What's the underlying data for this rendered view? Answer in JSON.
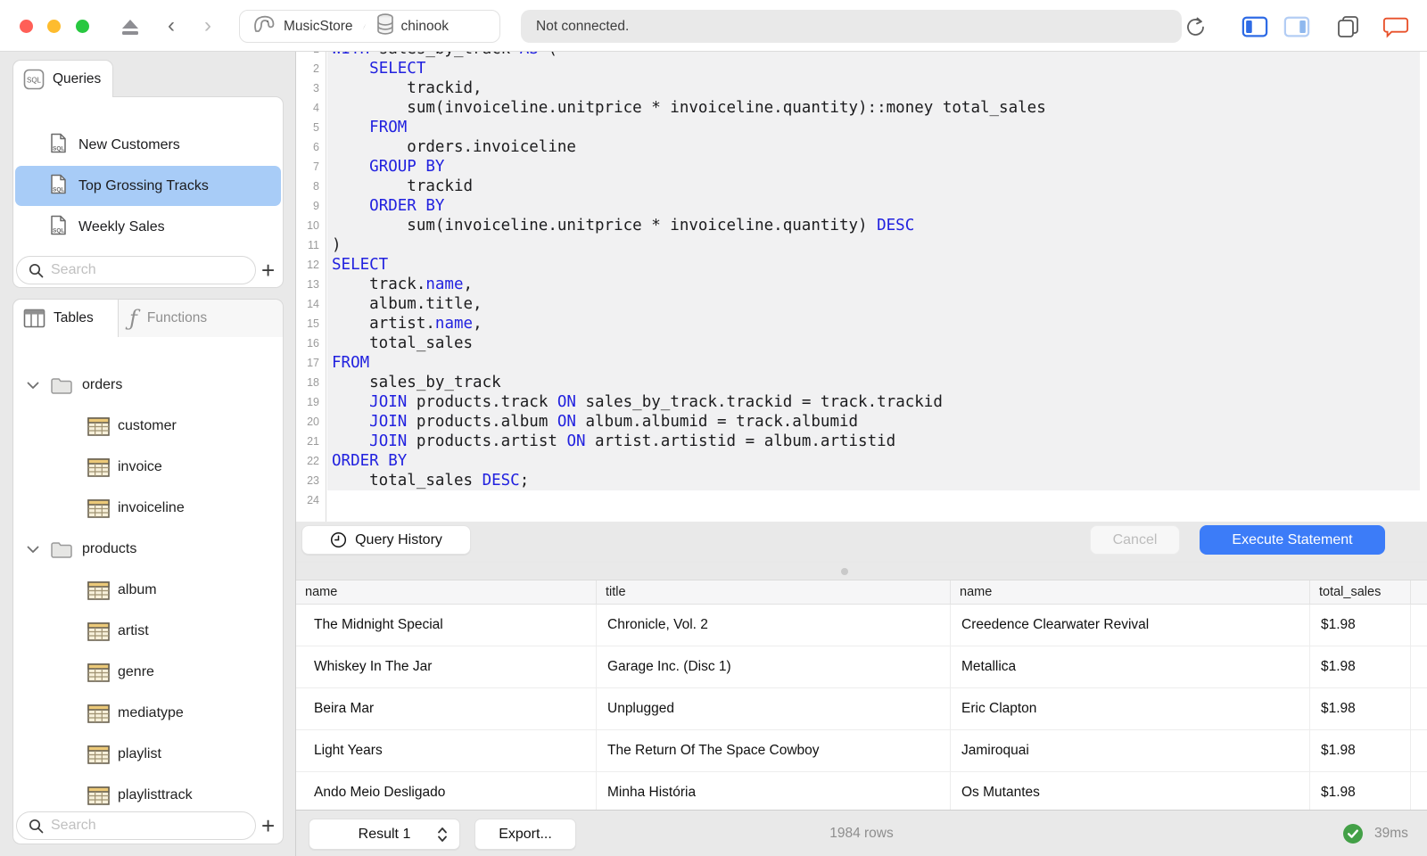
{
  "colors": {
    "accent_blue": "#3c7cf8",
    "selection_blue": "#a8ccf7",
    "keyword_blue": "#2121df",
    "success_green": "#43a047",
    "chat_orange": "#e8512a"
  },
  "titlebar": {
    "breadcrumb": [
      {
        "icon": "elephant-icon",
        "label": "MusicStore"
      },
      {
        "icon": "database-icon",
        "label": "chinook"
      }
    ],
    "status": "Not connected."
  },
  "queries_panel": {
    "tab_label": "Queries",
    "items": [
      {
        "label": "New Customers",
        "selected": false
      },
      {
        "label": "Top Grossing Tracks",
        "selected": true
      },
      {
        "label": "Weekly Sales",
        "selected": false
      }
    ],
    "search_placeholder": "Search"
  },
  "schema_panel": {
    "tabs": [
      {
        "label": "Tables",
        "selected": true
      },
      {
        "label": "Functions",
        "selected": false
      }
    ],
    "tree": [
      {
        "type": "folder",
        "label": "orders",
        "expanded": true
      },
      {
        "type": "table",
        "label": "customer"
      },
      {
        "type": "table",
        "label": "invoice"
      },
      {
        "type": "table",
        "label": "invoiceline"
      },
      {
        "type": "folder",
        "label": "products",
        "expanded": true
      },
      {
        "type": "table",
        "label": "album"
      },
      {
        "type": "table",
        "label": "artist"
      },
      {
        "type": "table",
        "label": "genre"
      },
      {
        "type": "table",
        "label": "mediatype"
      },
      {
        "type": "table",
        "label": "playlist"
      },
      {
        "type": "table",
        "label": "playlisttrack"
      }
    ],
    "search_placeholder": "Search"
  },
  "editor": {
    "query_history_label": "Query History",
    "cancel_label": "Cancel",
    "execute_label": "Execute Statement",
    "lines": [
      [
        [
          "WITH",
          1
        ],
        [
          " sales_by_track ",
          0
        ],
        [
          "AS",
          1
        ],
        [
          " (",
          0
        ]
      ],
      [
        [
          "    ",
          0
        ],
        [
          "SELECT",
          1
        ]
      ],
      [
        [
          "        trackid,",
          0
        ]
      ],
      [
        [
          "        sum(invoiceline.unitprice * invoiceline.quantity)::money total_sales",
          0
        ]
      ],
      [
        [
          "    ",
          0
        ],
        [
          "FROM",
          1
        ]
      ],
      [
        [
          "        orders.invoiceline",
          0
        ]
      ],
      [
        [
          "    ",
          0
        ],
        [
          "GROUP BY",
          1
        ]
      ],
      [
        [
          "        trackid",
          0
        ]
      ],
      [
        [
          "    ",
          0
        ],
        [
          "ORDER BY",
          1
        ]
      ],
      [
        [
          "        sum(invoiceline.unitprice * invoiceline.quantity) ",
          0
        ],
        [
          "DESC",
          1
        ]
      ],
      [
        [
          ")",
          0
        ]
      ],
      [
        [
          "SELECT",
          1
        ]
      ],
      [
        [
          "    track.",
          0
        ],
        [
          "name",
          1
        ],
        [
          ",",
          0
        ]
      ],
      [
        [
          "    album.title,",
          0
        ]
      ],
      [
        [
          "    artist.",
          0
        ],
        [
          "name",
          1
        ],
        [
          ",",
          0
        ]
      ],
      [
        [
          "    total_sales",
          0
        ]
      ],
      [
        [
          "FROM",
          1
        ]
      ],
      [
        [
          "    sales_by_track",
          0
        ]
      ],
      [
        [
          "    ",
          0
        ],
        [
          "JOIN",
          1
        ],
        [
          " products.track ",
          0
        ],
        [
          "ON",
          1
        ],
        [
          " sales_by_track.trackid = track.trackid",
          0
        ]
      ],
      [
        [
          "    ",
          0
        ],
        [
          "JOIN",
          1
        ],
        [
          " products.album ",
          0
        ],
        [
          "ON",
          1
        ],
        [
          " album.albumid = track.albumid",
          0
        ]
      ],
      [
        [
          "    ",
          0
        ],
        [
          "JOIN",
          1
        ],
        [
          " products.artist ",
          0
        ],
        [
          "ON",
          1
        ],
        [
          " artist.artistid = album.artistid",
          0
        ]
      ],
      [
        [
          "ORDER BY",
          1
        ]
      ],
      [
        [
          "    total_sales ",
          0
        ],
        [
          "DESC",
          1
        ],
        [
          ";",
          0
        ]
      ],
      []
    ]
  },
  "results": {
    "columns": [
      "name",
      "title",
      "name",
      "total_sales"
    ],
    "rows": [
      [
        "The Midnight Special",
        "Chronicle, Vol. 2",
        "Creedence Clearwater Revival",
        "$1.98"
      ],
      [
        "Whiskey In The Jar",
        "Garage Inc. (Disc 1)",
        "Metallica",
        "$1.98"
      ],
      [
        "Beira Mar",
        "Unplugged",
        "Eric Clapton",
        "$1.98"
      ],
      [
        "Light Years",
        "The Return Of The Space Cowboy",
        "Jamiroquai",
        "$1.98"
      ],
      [
        "Ando Meio Desligado",
        "Minha História",
        "Os Mutantes",
        "$1.98"
      ]
    ],
    "selector_label": "Result 1",
    "export_label": "Export...",
    "row_count": "1984 rows",
    "duration": "39ms"
  }
}
